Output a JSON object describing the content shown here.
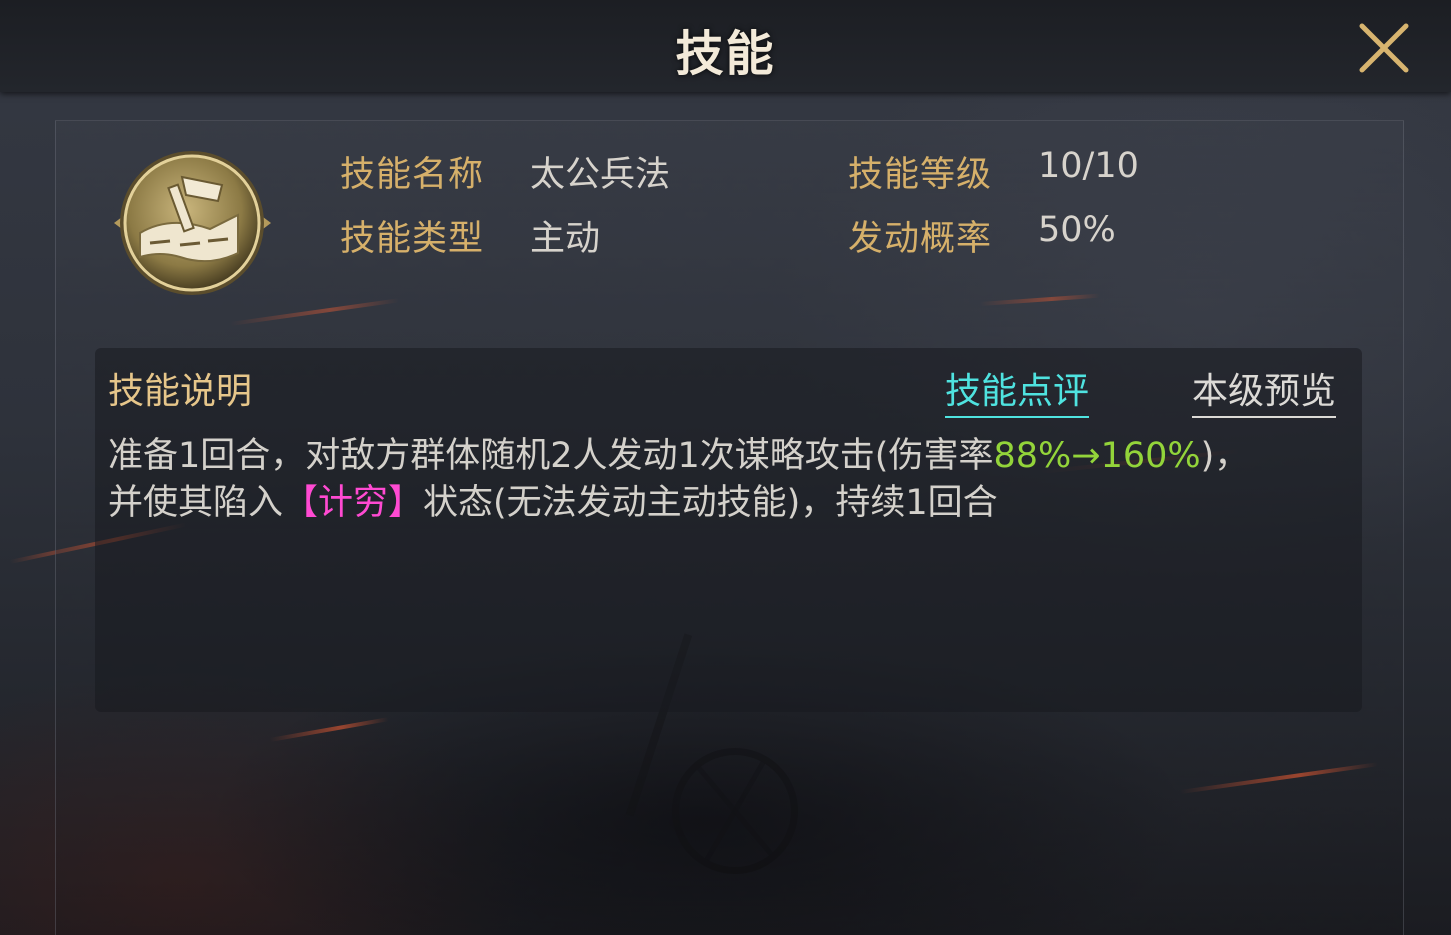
{
  "header": {
    "title": "技能"
  },
  "close_button": {
    "icon": "close-icon"
  },
  "skill": {
    "icon": "war-flag-scroll-icon",
    "name_label": "技能名称",
    "name_value": "太公兵法",
    "level_label": "技能等级",
    "level_value": "10/10",
    "type_label": "技能类型",
    "type_value": "主动",
    "rate_label": "发动概率",
    "rate_value": "50%"
  },
  "description": {
    "title": "技能说明",
    "tab_review": "技能点评",
    "tab_preview": "本级预览",
    "line1_text": "准备1回合，对敌方群体随机2人发动1次谋略攻击(伤害率",
    "line1_highlight": "88%→160%",
    "line1_end": ")，",
    "line2_start": "并使其陷入",
    "line2_highlight": "【计穷】",
    "line2_end": "状态(无法发动主动技能)，持续1回合"
  },
  "colors": {
    "label_gold": "#d6b06a",
    "link_cyan": "#4fe3e0",
    "highlight_green": "#93d43a",
    "highlight_pink": "#ff4ad2"
  }
}
